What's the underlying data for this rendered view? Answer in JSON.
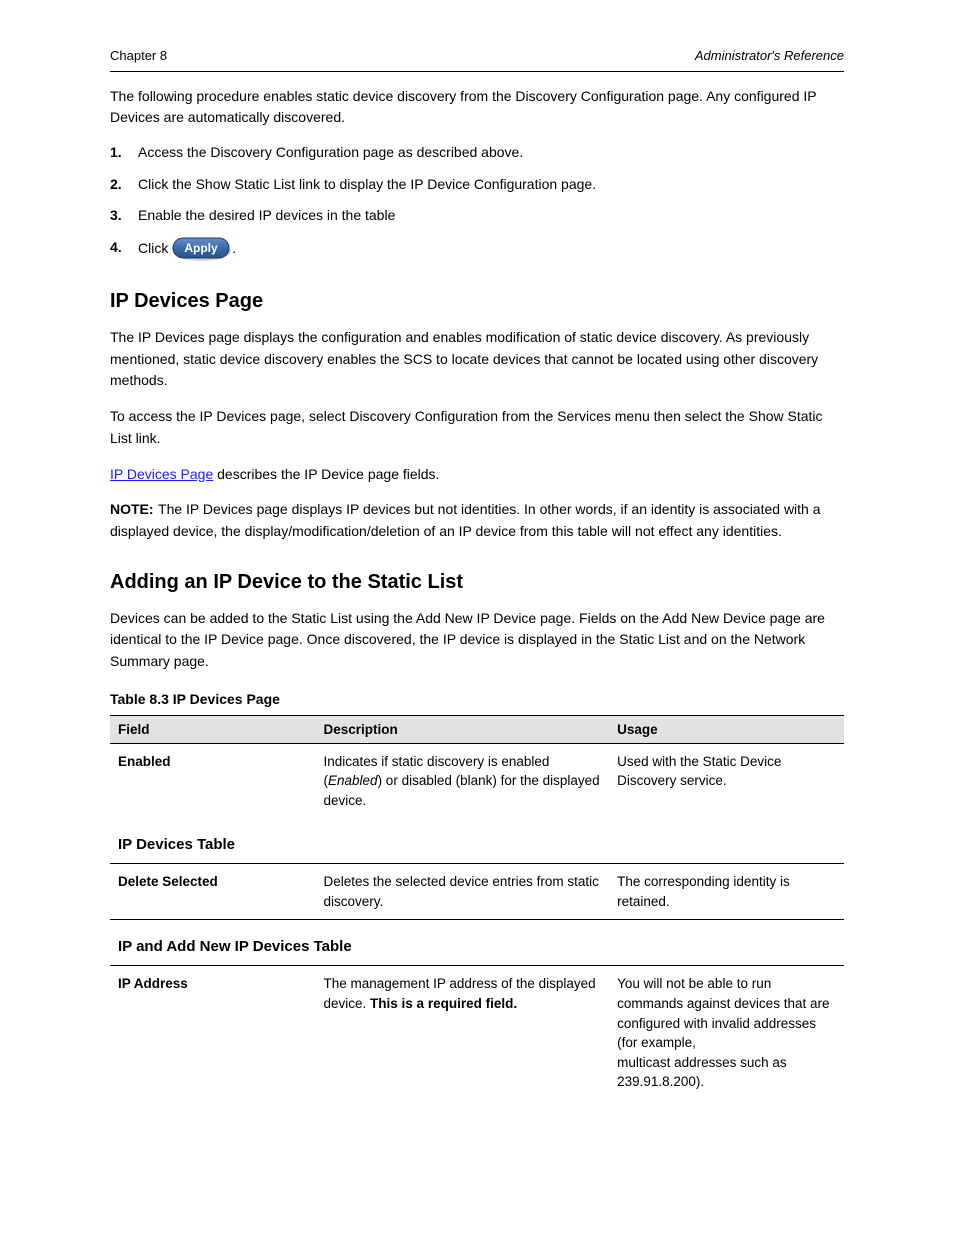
{
  "header": {
    "left": "Chapter 8",
    "right": "Administrator's Reference"
  },
  "intro": "The following procedure enables static device discovery from the Discovery Configuration page. Any configured IP Devices are automatically discovered.",
  "steps": [
    "Access the Discovery Configuration page as described above.",
    "Click the Show Static List link to display the IP Device Configuration page.",
    "Enable the desired IP devices in the table",
    {
      "prefix": "Click ",
      "suffix": "."
    }
  ],
  "apply_button": {
    "label": "Apply"
  },
  "section_heading": "IP Devices Page",
  "ip_overview": "The IP Devices page displays the configuration and enables modification of static device discovery. As previously mentioned, static device discovery enables the SCS to locate devices that cannot be located using other discovery methods.",
  "menu_path": "To access the IP Devices page, select Discovery Configuration from the Services menu then select the Show Static List link.",
  "cross_ref": {
    "label": "IP Devices Page",
    "text": " describes the IP Device page fields."
  },
  "note": {
    "label": "NOTE:",
    "text": "The IP Devices page displays IP devices but not identities. In other words, if an identity is associated with a displayed device, the display/modification/deletion of an IP device from this table will not effect any identities."
  },
  "adding_heading": "Adding an IP Device to the Static List",
  "adding_para": "Devices can be added to the Static List using the Add New IP Device page. Fields on the Add New Device page are identical to the IP Device page. Once discovered, the IP device is displayed in the Static List and on the Network Summary page.",
  "table": {
    "title": "Table 8.3   IP Devices Page",
    "columns": [
      "Field",
      "Description",
      "Usage"
    ],
    "section1": {
      "heading": "IP Devices Table",
      "rows": [
        {
          "field": "Enabled",
          "desc": [
            "Indicates if static discovery is enabled (",
            "Enabled",
            ") or disabled (blank) for the displayed device."
          ],
          "usage": "Used with the Static Device Discovery service."
        },
        {
          "field": "Delete Selected",
          "desc": "Deletes the selected device entries from static discovery.",
          "usage": "The corresponding identity is retained."
        }
      ]
    },
    "section2": {
      "heading": "IP and Add New IP Devices Table",
      "rows": [
        {
          "field": "IP Address",
          "desc": [
            "The management IP address of the displayed device. ",
            "This is a required field."
          ],
          "usage": [
            "You will not be able to run commands against devices that are configured with invalid addresses (for example,",
            "multicast addresses such as 239.91.8.200)."
          ]
        }
      ]
    }
  }
}
